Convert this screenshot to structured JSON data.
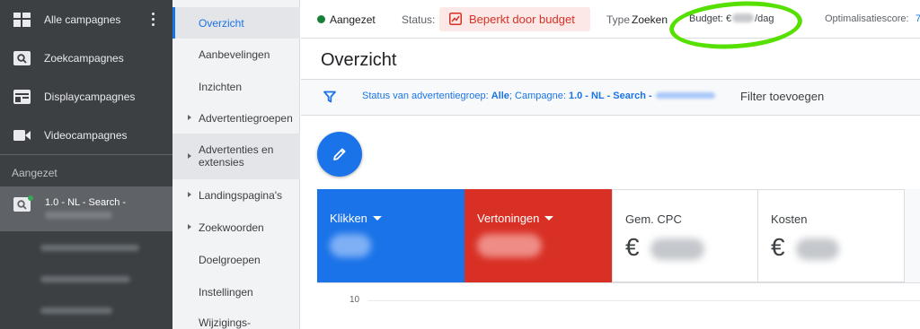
{
  "sidebar": {
    "items": [
      {
        "label": "Alle campagnes",
        "icon": "dashboard-icon"
      },
      {
        "label": "Zoekcampagnes",
        "icon": "search-campaign-icon"
      },
      {
        "label": "Displaycampagnes",
        "icon": "display-campaign-icon"
      },
      {
        "label": "Videocampagnes",
        "icon": "video-campaign-icon"
      }
    ],
    "section_label": "Aangezet",
    "active_campaign": {
      "label": "1.0 - NL - Search -",
      "icon": "search-campaign-icon",
      "status_color": "#34a853"
    }
  },
  "subnav": {
    "items": [
      {
        "label": "Overzicht",
        "active": true
      },
      {
        "label": "Aanbevelingen"
      },
      {
        "label": "Inzichten"
      },
      {
        "label": "Advertentiegroepen",
        "expandable": true
      },
      {
        "label": "Advertenties en extensies",
        "expandable": true
      },
      {
        "label": "Landingspagina's",
        "expandable": true
      },
      {
        "label": "Zoekwoorden",
        "expandable": true
      },
      {
        "label": "Doelgroepen"
      },
      {
        "label": "Instellingen"
      },
      {
        "label": "Wijzigings-"
      }
    ]
  },
  "topbar": {
    "enabled": "Aangezet",
    "status_label": "Status:",
    "status_value": "Beperkt door budget",
    "type_label": "Type",
    "type_value": "Zoeken",
    "budget_prefix": "Budget: €",
    "budget_suffix": "/dag",
    "optimization_label": "Optimalisatiescore:",
    "optimization_value": "7",
    "highlight_color": "#55e000"
  },
  "page": {
    "title": "Overzicht"
  },
  "filter": {
    "prefix": "Status van advertentiegroep: ",
    "status_value": "Alle",
    "campaign_prefix": "; Campagne: ",
    "campaign_value": "1.0 - NL - Search -",
    "add_label": "Filter toevoegen"
  },
  "metrics": [
    {
      "label": "Klikken",
      "dropdown": true,
      "color": "#1a73e8"
    },
    {
      "label": "Vertoningen",
      "dropdown": true,
      "color": "#d93025"
    },
    {
      "label": "Gem. CPC",
      "currency": "€"
    },
    {
      "label": "Kosten",
      "currency": "€"
    }
  ],
  "chart": {
    "y_tick": "10"
  }
}
